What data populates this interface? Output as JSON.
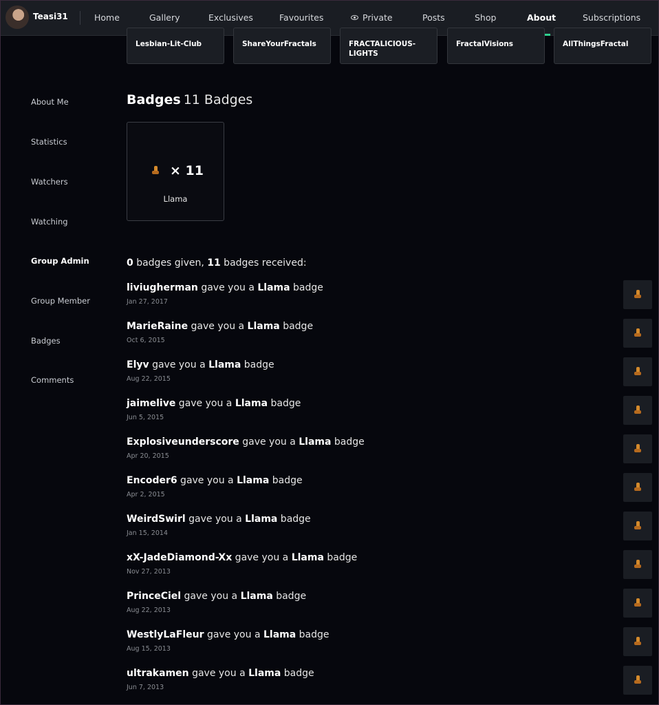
{
  "nav": {
    "username": "Teasi31",
    "items": [
      "Home",
      "Gallery",
      "Exclusives",
      "Favourites",
      "Private",
      "Posts",
      "Shop",
      "About",
      "Subscriptions"
    ],
    "active": "About"
  },
  "groups": [
    "Lesbian-Lit-Club",
    "ShareYourFractals",
    "FRACTALICIOUS-LIGHTS",
    "FractalVisions",
    "AllThingsFractal"
  ],
  "sidebar": [
    "About Me",
    "Statistics",
    "Watchers",
    "Watching",
    "Group Admin",
    "Group Member",
    "Badges",
    "Comments"
  ],
  "badges": {
    "title": "Badges",
    "count_label": "11 Badges",
    "card": {
      "multiplier": "× 11",
      "name": "Llama"
    },
    "summary": {
      "given": "0",
      "given_text": " badges given, ",
      "received": "11",
      "received_text": " badges received:"
    }
  },
  "entries": [
    {
      "user": "liviugherman",
      "mid": " gave you a ",
      "badge": "Llama",
      "end": " badge",
      "date": "Jan 27, 2017"
    },
    {
      "user": "MarieRaine",
      "mid": " gave you a ",
      "badge": "Llama",
      "end": " badge",
      "date": "Oct 6, 2015"
    },
    {
      "user": "Elyv",
      "mid": " gave you a ",
      "badge": "Llama",
      "end": " badge",
      "date": "Aug 22, 2015"
    },
    {
      "user": "jaimelive",
      "mid": " gave you a ",
      "badge": "Llama",
      "end": " badge",
      "date": "Jun 5, 2015"
    },
    {
      "user": "Explosiveunderscore",
      "mid": " gave you a ",
      "badge": "Llama",
      "end": " badge",
      "date": "Apr 20, 2015"
    },
    {
      "user": "Encoder6",
      "mid": " gave you a ",
      "badge": "Llama",
      "end": " badge",
      "date": "Apr 2, 2015"
    },
    {
      "user": "WeirdSwirl",
      "mid": " gave you a ",
      "badge": "Llama",
      "end": " badge",
      "date": "Jan 15, 2014"
    },
    {
      "user": "xX-JadeDiamond-Xx",
      "mid": " gave you a ",
      "badge": "Llama",
      "end": " badge",
      "date": "Nov 27, 2013"
    },
    {
      "user": "PrinceCiel",
      "mid": " gave you a ",
      "badge": "Llama",
      "end": " badge",
      "date": "Aug 22, 2013"
    },
    {
      "user": "WestlyLaFleur",
      "mid": " gave you a ",
      "badge": "Llama",
      "end": " badge",
      "date": "Aug 15, 2013"
    },
    {
      "user": "ultrakamen",
      "mid": " gave you a ",
      "badge": "Llama",
      "end": " badge",
      "date": "Jun 7, 2013"
    }
  ],
  "colors": {
    "accent": "#2fd08f",
    "background": "#06070d",
    "nav": "#1a1d23"
  }
}
